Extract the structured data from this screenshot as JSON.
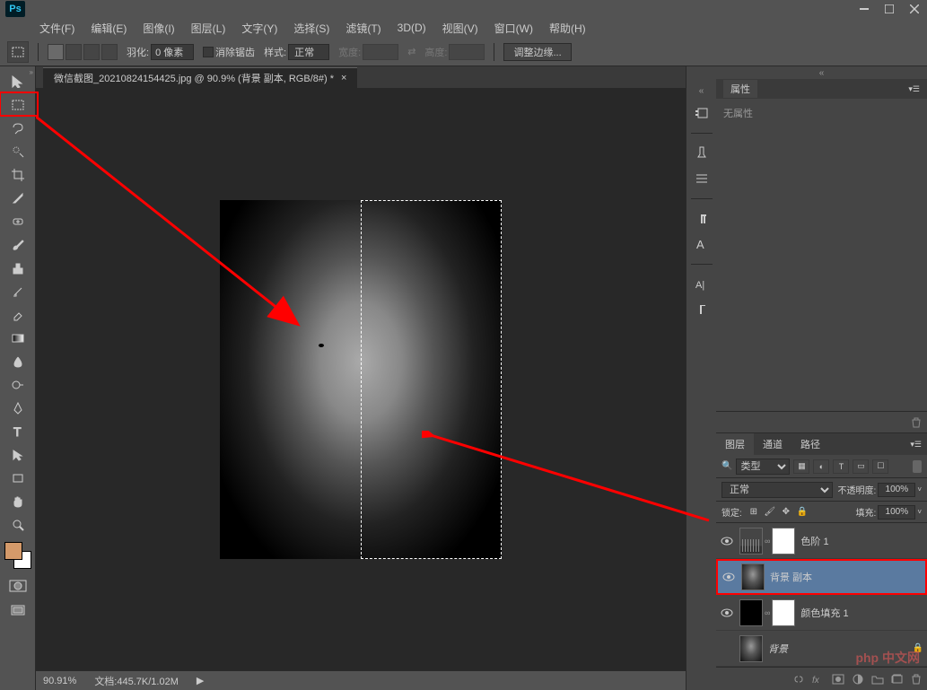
{
  "app": {
    "logo": "Ps"
  },
  "menu": [
    {
      "label": "文件(F)"
    },
    {
      "label": "编辑(E)"
    },
    {
      "label": "图像(I)"
    },
    {
      "label": "图层(L)"
    },
    {
      "label": "文字(Y)"
    },
    {
      "label": "选择(S)"
    },
    {
      "label": "滤镜(T)"
    },
    {
      "label": "3D(D)"
    },
    {
      "label": "视图(V)"
    },
    {
      "label": "窗口(W)"
    },
    {
      "label": "帮助(H)"
    }
  ],
  "options": {
    "feather_label": "羽化:",
    "feather_value": "0 像素",
    "antialias_label": "消除锯齿",
    "style_label": "样式:",
    "style_value": "正常",
    "width_label": "宽度:",
    "height_label": "高度:",
    "refine_edge": "调整边缘..."
  },
  "tab": {
    "title": "微信截图_20210824154425.jpg @ 90.9% (背景 副本, RGB/8#) *"
  },
  "statusbar": {
    "zoom": "90.91%",
    "doc_label": "文档:",
    "doc_size": "445.7K/1.02M"
  },
  "properties_panel": {
    "tab": "属性",
    "content": "无属性"
  },
  "layers_panel": {
    "tabs": [
      "图层",
      "通道",
      "路径"
    ],
    "filter_type": "类型",
    "blend_mode": "正常",
    "opacity_label": "不透明度:",
    "opacity_value": "100%",
    "lock_label": "锁定:",
    "fill_label": "填充:",
    "fill_value": "100%",
    "layers": [
      {
        "name": "色阶 1",
        "type": "levels",
        "visible": true,
        "masked": true
      },
      {
        "name": "背景 副本",
        "type": "image",
        "visible": true,
        "selected": true
      },
      {
        "name": "颜色填充 1",
        "type": "solid",
        "visible": true,
        "masked": true
      },
      {
        "name": "背景",
        "type": "bg",
        "visible": true,
        "locked": true,
        "italic": true
      }
    ]
  },
  "watermark": "php 中文网"
}
